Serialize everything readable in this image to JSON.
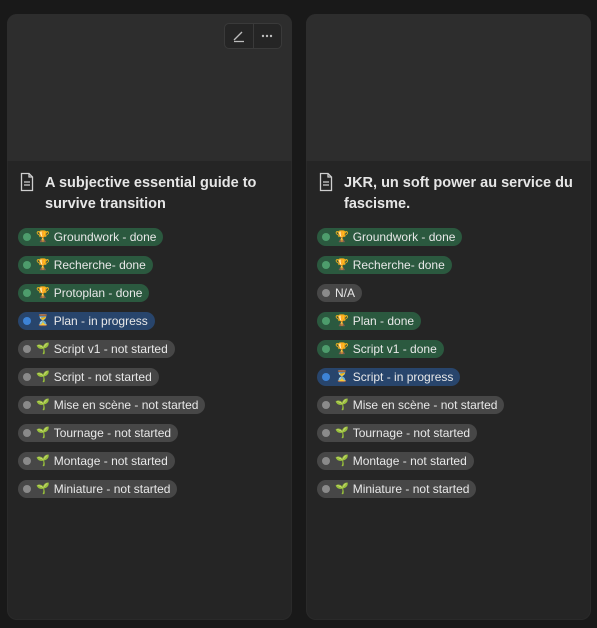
{
  "cards": [
    {
      "title_line1": "A subjective essential guide to",
      "title_line2": "survive transition",
      "tags": [
        {
          "label": "Groundwork - done",
          "color": "green",
          "glyph": "🏆"
        },
        {
          "label": "Recherche- done",
          "color": "green",
          "glyph": "🏆"
        },
        {
          "label": "Protoplan - done",
          "color": "green",
          "glyph": "🏆"
        },
        {
          "label": "Plan - in progress",
          "color": "blue",
          "glyph": "⏳"
        },
        {
          "label": "Script v1 - not started",
          "color": "gray",
          "glyph": "🌱"
        },
        {
          "label": "Script - not started",
          "color": "gray",
          "glyph": "🌱"
        },
        {
          "label": "Mise en scène - not started",
          "color": "gray",
          "glyph": "🌱"
        },
        {
          "label": "Tournage - not started",
          "color": "gray",
          "glyph": "🌱"
        },
        {
          "label": "Montage - not started",
          "color": "gray",
          "glyph": "🌱"
        },
        {
          "label": "Miniature - not started",
          "color": "gray",
          "glyph": "🌱"
        }
      ]
    },
    {
      "title_line1": "JKR, un soft power au service du",
      "title_line2": "fascisme.",
      "tags": [
        {
          "label": "Groundwork - done",
          "color": "green",
          "glyph": "🏆"
        },
        {
          "label": "Recherche- done",
          "color": "green",
          "glyph": "🏆"
        },
        {
          "label": "N/A",
          "color": "gray",
          "glyph": ""
        },
        {
          "label": "Plan - done",
          "color": "green",
          "glyph": "🏆"
        },
        {
          "label": "Script v1 - done",
          "color": "green",
          "glyph": "🏆"
        },
        {
          "label": "Script - in progress",
          "color": "blue",
          "glyph": "⏳"
        },
        {
          "label": "Mise en scène - not started",
          "color": "gray",
          "glyph": "🌱"
        },
        {
          "label": "Tournage - not started",
          "color": "gray",
          "glyph": "🌱"
        },
        {
          "label": "Montage - not started",
          "color": "gray",
          "glyph": "🌱"
        },
        {
          "label": "Miniature - not started",
          "color": "gray",
          "glyph": "🌱"
        }
      ]
    }
  ],
  "colors": {
    "green": "#2b593f",
    "blue": "#28456c",
    "gray": "#474747",
    "card": "#252525",
    "background": "#191919"
  },
  "toolbar_icons": [
    "edit-pencil-icon",
    "more-dots-icon"
  ]
}
